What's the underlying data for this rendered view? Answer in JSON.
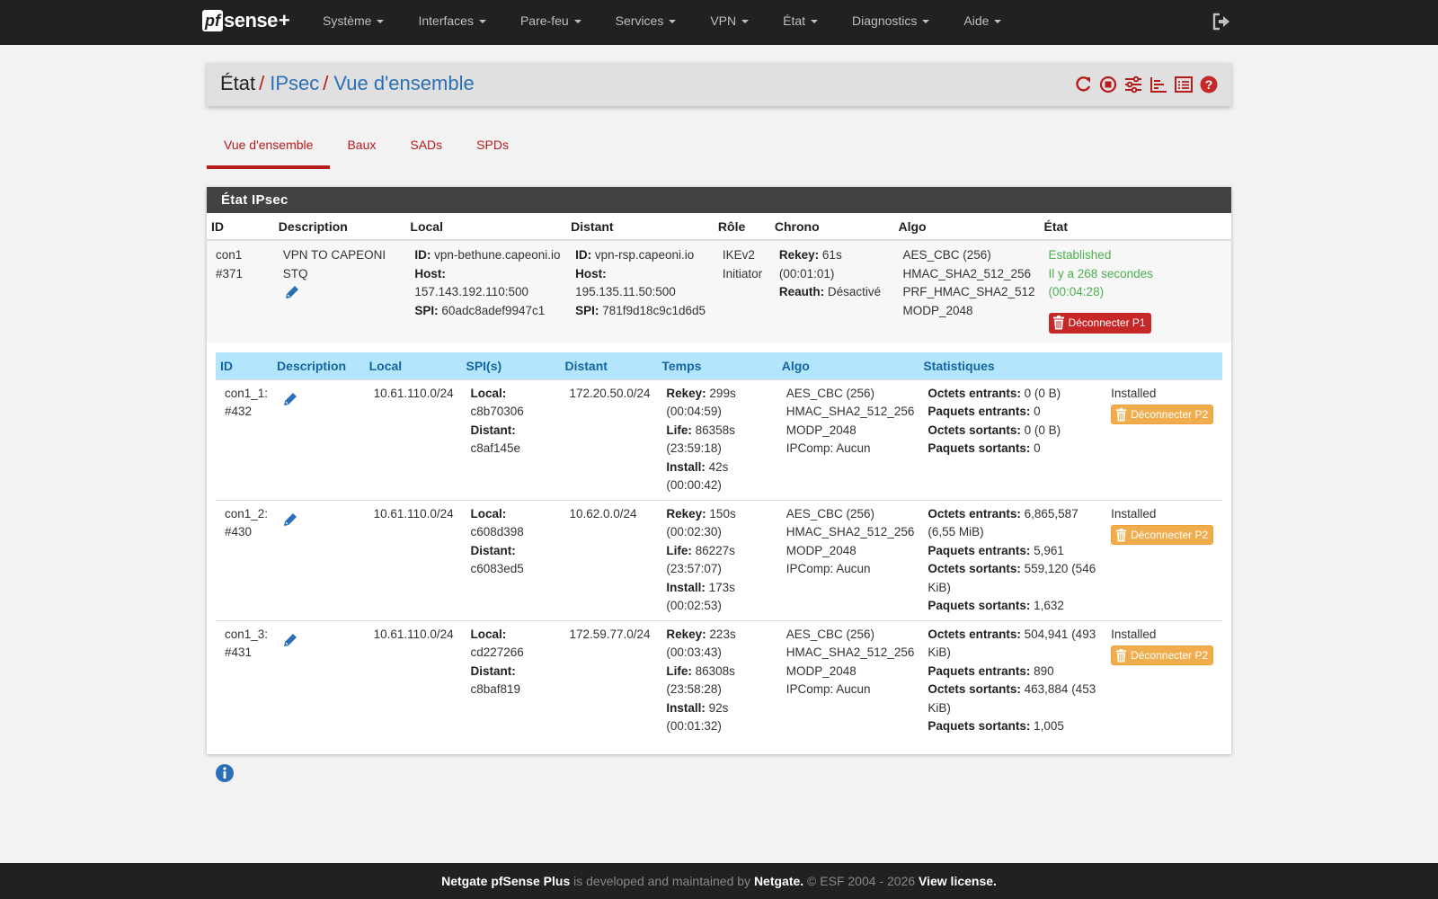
{
  "brand": {
    "pf": "pf",
    "sense": "sense",
    "plus": "+"
  },
  "nav": [
    "Système",
    "Interfaces",
    "Pare-feu",
    "Services",
    "VPN",
    "État",
    "Diagnostics",
    "Aide"
  ],
  "breadcrumb": {
    "root": "État",
    "sep": "/",
    "level1": "IPsec",
    "level2": "Vue d'ensemble"
  },
  "tabs": [
    "Vue d'ensemble",
    "Baux",
    "SADs",
    "SPDs"
  ],
  "panel": {
    "title": "État IPsec",
    "headers": [
      "ID",
      "Description",
      "Local",
      "Distant",
      "Rôle",
      "Chrono",
      "Algo",
      "État"
    ],
    "p1": {
      "id": "con1",
      "num": "#371",
      "description": "VPN TO CAPEONI STQ",
      "local": {
        "id_label": "ID:",
        "id": "vpn-bethune.capeoni.io",
        "host_label": "Host:",
        "host": "157.143.192.110:500",
        "spi_label": "SPI:",
        "spi": "60adc8adef9947c1"
      },
      "remote": {
        "id_label": "ID:",
        "id": "vpn-rsp.capeoni.io",
        "host_label": "Host:",
        "host": "195.135.11.50:500",
        "spi_label": "SPI:",
        "spi": "781f9d18c9c1d6d5"
      },
      "role": "IKEv2",
      "role2": "Initiator",
      "rekey_label": "Rekey:",
      "rekey": "61s",
      "rekey_time": "(00:01:01)",
      "reauth_label": "Reauth:",
      "reauth": "Désactivé",
      "algo": [
        "AES_CBC (256)",
        "HMAC_SHA2_512_256",
        "PRF_HMAC_SHA2_512",
        "MODP_2048"
      ],
      "status": "Established",
      "since": "Il y a 268 secondes",
      "since_time": "(00:04:28)",
      "disconnect": "Déconnecter P1"
    },
    "child_headers": [
      "ID",
      "Description",
      "Local",
      "SPI(s)",
      "Distant",
      "Temps",
      "Algo",
      "Statistiques"
    ],
    "children": [
      {
        "id": "con1_1:",
        "num": "#432",
        "local": "10.61.110.0/24",
        "spi_local_label": "Local:",
        "spi_local": "c8b70306",
        "spi_remote_label": "Distant:",
        "spi_remote": "c8af145e",
        "remote": "172.20.50.0/24",
        "rekey_label": "Rekey:",
        "rekey": "299s",
        "rekey_time": "(00:04:59)",
        "life_label": "Life:",
        "life": "86358s",
        "life_time": "(23:59:18)",
        "install_label": "Install:",
        "install": "42s",
        "install_time": "(00:00:42)",
        "algo": [
          "AES_CBC (256)",
          "HMAC_SHA2_512_256",
          "MODP_2048",
          "IPComp: Aucun"
        ],
        "in_bytes_label": "Octets entrants:",
        "in_bytes": "0 (0 B)",
        "in_pkts_label": "Paquets entrants:",
        "in_pkts": "0",
        "out_bytes_label": "Octets sortants:",
        "out_bytes": "0 (0 B)",
        "out_pkts_label": "Paquets sortants:",
        "out_pkts": "0",
        "status": "Installed",
        "disconnect": "Déconnecter P2"
      },
      {
        "id": "con1_2:",
        "num": "#430",
        "local": "10.61.110.0/24",
        "spi_local_label": "Local:",
        "spi_local": "c608d398",
        "spi_remote_label": "Distant:",
        "spi_remote": "c6083ed5",
        "remote": "10.62.0.0/24",
        "rekey_label": "Rekey:",
        "rekey": "150s",
        "rekey_time": "(00:02:30)",
        "life_label": "Life:",
        "life": "86227s",
        "life_time": "(23:57:07)",
        "install_label": "Install:",
        "install": "173s",
        "install_time": "(00:02:53)",
        "algo": [
          "AES_CBC (256)",
          "HMAC_SHA2_512_256",
          "MODP_2048",
          "IPComp: Aucun"
        ],
        "in_bytes_label": "Octets entrants:",
        "in_bytes": "6,865,587 (6,55 MiB)",
        "in_pkts_label": "Paquets entrants:",
        "in_pkts": "5,961",
        "out_bytes_label": "Octets sortants:",
        "out_bytes": "559,120 (546 KiB)",
        "out_pkts_label": "Paquets sortants:",
        "out_pkts": "1,632",
        "status": "Installed",
        "disconnect": "Déconnecter P2"
      },
      {
        "id": "con1_3:",
        "num": "#431",
        "local": "10.61.110.0/24",
        "spi_local_label": "Local:",
        "spi_local": "cd227266",
        "spi_remote_label": "Distant:",
        "spi_remote": "c8baf819",
        "remote": "172.59.77.0/24",
        "rekey_label": "Rekey:",
        "rekey": "223s",
        "rekey_time": "(00:03:43)",
        "life_label": "Life:",
        "life": "86308s",
        "life_time": "(23:58:28)",
        "install_label": "Install:",
        "install": "92s",
        "install_time": "(00:01:32)",
        "algo": [
          "AES_CBC (256)",
          "HMAC_SHA2_512_256",
          "MODP_2048",
          "IPComp: Aucun"
        ],
        "in_bytes_label": "Octets entrants:",
        "in_bytes": "504,941 (493 KiB)",
        "in_pkts_label": "Paquets entrants:",
        "in_pkts": "890",
        "out_bytes_label": "Octets sortants:",
        "out_bytes": "463,884 (453 KiB)",
        "out_pkts_label": "Paquets sortants:",
        "out_pkts": "1,005",
        "status": "Installed",
        "disconnect": "Déconnecter P2"
      }
    ]
  },
  "footer": {
    "product": "Netgate pfSense Plus",
    "text1": " is developed and maintained by ",
    "company": "Netgate.",
    "text2": " © ESF 2004 - 2026 ",
    "license": "View license."
  },
  "icons": [
    "refresh-icon",
    "stop-icon",
    "settings-icon",
    "chart-icon",
    "log-icon",
    "help-icon",
    "edit-icon",
    "trash-icon",
    "info-icon",
    "logout-icon"
  ],
  "colors": {
    "navbar": "#212121",
    "accent_red": "#b71c1c",
    "link_blue": "#2b70b7",
    "established_green": "#4caf50",
    "child_header_bg": "#b3e5fc",
    "warning_orange": "#f0ad4e"
  }
}
